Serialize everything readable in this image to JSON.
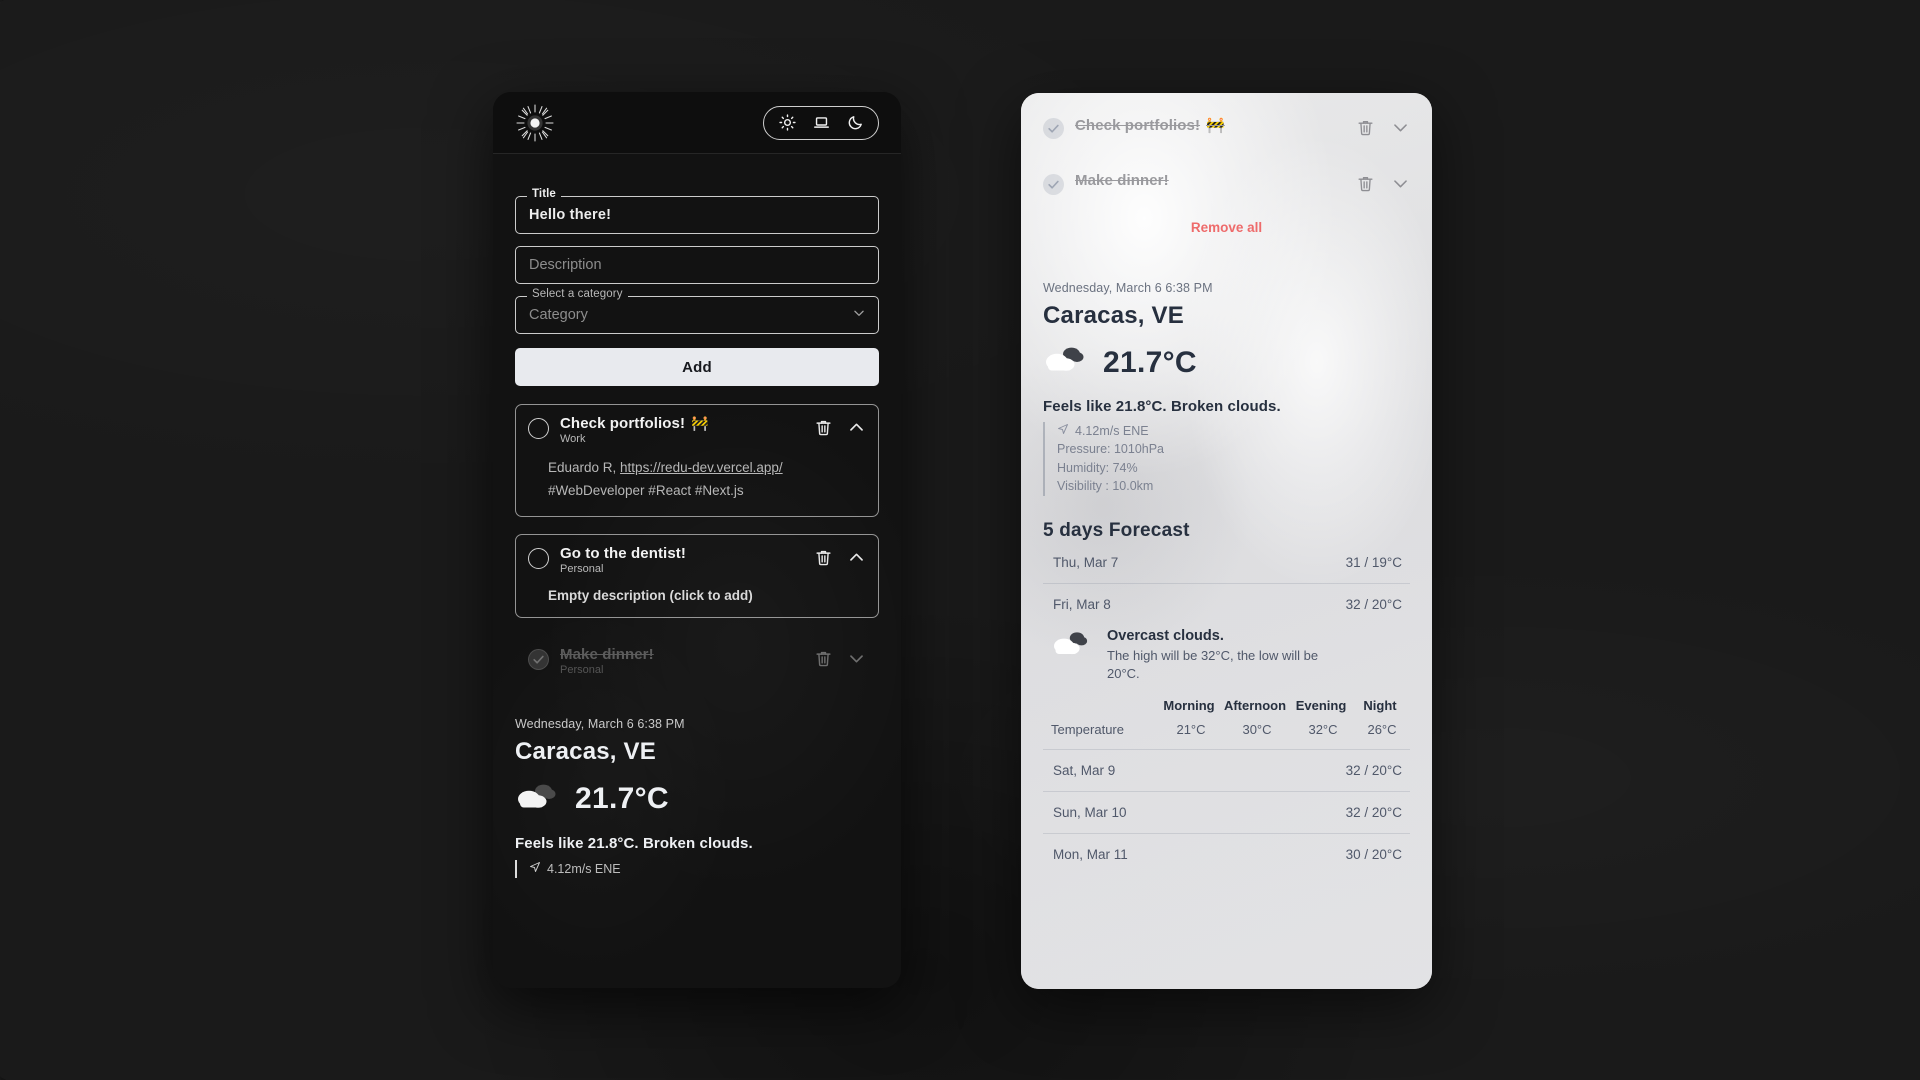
{
  "app": {
    "logo_name": "sunburst-logo"
  },
  "theme_toggle": {
    "options": [
      {
        "name": "light",
        "icon": "sun-icon"
      },
      {
        "name": "system",
        "icon": "laptop-icon"
      },
      {
        "name": "dark",
        "icon": "moon-icon"
      }
    ]
  },
  "form": {
    "title_legend": "Title",
    "title_value": "Hello  there!",
    "description_placeholder": "Description",
    "description_value": "",
    "category_legend": "Select a category",
    "category_value": "Category",
    "add_label": "Add"
  },
  "todos": [
    {
      "title": "Check portfolios!",
      "emoji": "🚧",
      "category": "Work",
      "done": false,
      "expanded": true,
      "description_prefix": "Eduardo R, ",
      "description_link": "https://redu-dev.vercel.app/",
      "tags": "#WebDeveloper #React #Next.js",
      "empty_description": "",
      "chevron": "chevron-up-icon"
    },
    {
      "title": "Go to the dentist!",
      "emoji": "",
      "category": "Personal",
      "done": false,
      "expanded": true,
      "description_prefix": "",
      "description_link": "",
      "tags": "",
      "empty_description": "Empty description (click to add)",
      "chevron": "chevron-up-icon"
    },
    {
      "title": "Make dinner!",
      "emoji": "",
      "category": "Personal",
      "done": true,
      "expanded": false,
      "description_prefix": "",
      "description_link": "",
      "tags": "",
      "empty_description": "",
      "chevron": "chevron-down-icon"
    }
  ],
  "right_panel": {
    "completed_todos": [
      {
        "title": "Check portfolios!",
        "emoji": "🚧",
        "category": "",
        "chevron": "chevron-down-icon"
      },
      {
        "title": "Make dinner!",
        "emoji": "",
        "category": "",
        "chevron": "chevron-down-icon"
      }
    ],
    "remove_all_label": "Remove all",
    "remove_all_color": "#ee6b6b"
  },
  "weather": {
    "datetime": "Wednesday, March 6  6:38 PM",
    "city": "Caracas, VE",
    "temperature": "21.7°C",
    "condition_icon": "broken-clouds-icon",
    "feels_like": "Feels like 21.8°C.  Broken clouds.",
    "wind": "4.12m/s ENE",
    "pressure": "Pressure: 1010hPa",
    "humidity": "Humidity: 74%",
    "visibility": "Visibility : 10.0km"
  },
  "forecast": {
    "title": "5 days Forecast",
    "days": [
      {
        "day": "Thu, Mar 7",
        "highlow": "31 / 19°C",
        "expanded": false
      },
      {
        "day": "Fri, Mar 8",
        "highlow": "32 / 20°C",
        "expanded": true
      },
      {
        "day": "Sat, Mar 9",
        "highlow": "32 / 20°C",
        "expanded": false
      },
      {
        "day": "Sun, Mar 10",
        "highlow": "32 / 20°C",
        "expanded": false
      },
      {
        "day": "Mon, Mar 11",
        "highlow": "30 / 20°C",
        "expanded": false
      }
    ],
    "detail": {
      "summary_title": "Overcast clouds.",
      "summary_text": "The high will be 32°C, the low will be 20°C.",
      "icon": "overcast-clouds-icon",
      "columns": [
        "Morning",
        "Afternoon",
        "Evening",
        "Night"
      ],
      "row_label": "Temperature",
      "row_values": [
        "21°C",
        "30°C",
        "32°C",
        "26°C"
      ]
    }
  }
}
